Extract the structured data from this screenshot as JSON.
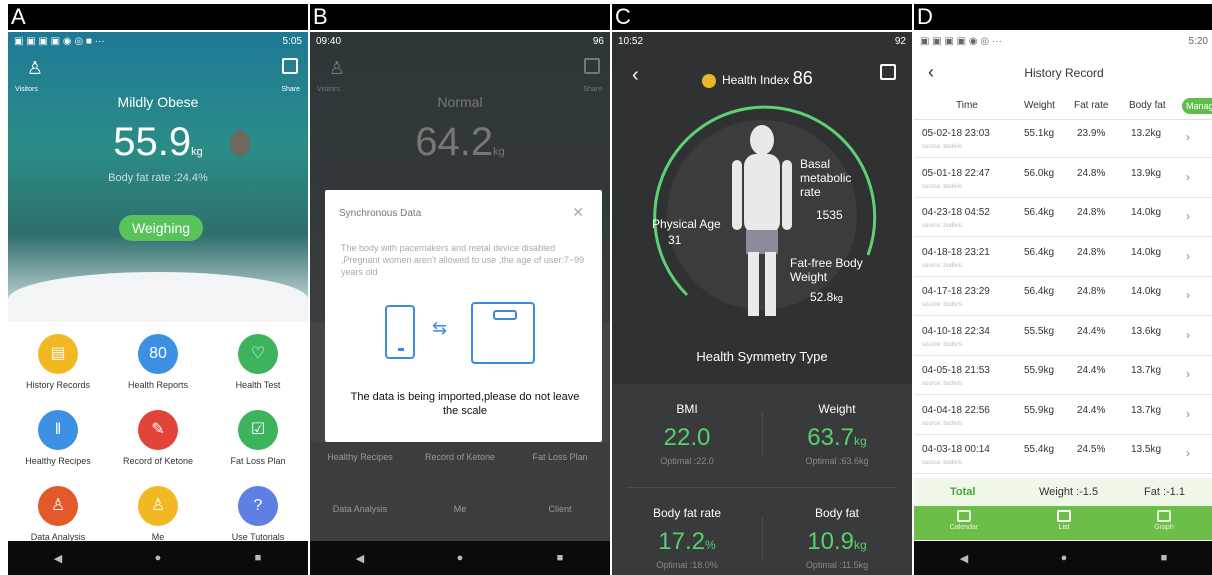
{
  "panels": {
    "a": {
      "label": "A",
      "status_time": "5:05",
      "visitors": "Visitors",
      "share": "Share",
      "status": "Mildly Obese",
      "weight": "55.9",
      "unit": "kg",
      "body_fat": "Body fat rate :24.4%",
      "weighing_button": "Weighing",
      "grid": [
        {
          "label": "History Records",
          "color": "#f2b824",
          "icon": "document-icon",
          "glyph": "▤"
        },
        {
          "label": "Health Reports",
          "color": "#3d8fe3",
          "icon": "score-icon",
          "glyph": "80"
        },
        {
          "label": "Health Test",
          "color": "#3cb35c",
          "icon": "heartbeat-icon",
          "glyph": "♡"
        },
        {
          "label": "Healthy Recipes",
          "color": "#3d8fe3",
          "icon": "fork-knife-icon",
          "glyph": "ǁ"
        },
        {
          "label": "Record of Ketone",
          "color": "#e3443a",
          "icon": "pen-icon",
          "glyph": "✎"
        },
        {
          "label": "Fat Loss Plan",
          "color": "#3cb35c",
          "icon": "clipboard-icon",
          "glyph": "☑"
        },
        {
          "label": "Data Analysis",
          "color": "#e35a2a",
          "icon": "person-pin-icon",
          "glyph": "♙"
        },
        {
          "label": "Me",
          "color": "#f2b824",
          "icon": "user-icon",
          "glyph": "♙"
        },
        {
          "label": "Use Tutorials",
          "color": "#5f7fe3",
          "icon": "chat-icon",
          "glyph": "?"
        }
      ]
    },
    "b": {
      "label": "B",
      "status_time": "09:40",
      "status_battery": "96",
      "visitors": "Visitors",
      "share": "Share",
      "status": "Normal",
      "weight": "64.2",
      "unit": "kg",
      "dialog_title": "Synchronous Data",
      "dialog_body": "The body with pacemakers and metal device disabled ,Pregnant women aren't allowed to use ,the age of user:7~99 years old",
      "dialog_message": "The data is being imported,please do not leave the scale",
      "grid_bottom": [
        "Healthy Recipes",
        "Record of Ketone",
        "Fat Loss Plan",
        "Data Analysis",
        "Me",
        "Client"
      ]
    },
    "c": {
      "label": "C",
      "status_time": "10:52",
      "status_battery": "92",
      "title": "Health Index",
      "index": "86",
      "physical_age_label": "Physical Age",
      "physical_age": "31",
      "bmr_label": "Basal metabolic rate",
      "bmr": "1535",
      "ffm_label": "Fat-free Body Weight",
      "ffm": "52.8",
      "ffm_unit": "kg",
      "symmetry": "Health Symmetry Type",
      "metrics": [
        {
          "label": "BMI",
          "value": "22.0",
          "unit": "",
          "optimal": "Optimal :22.0"
        },
        {
          "label": "Weight",
          "value": "63.7",
          "unit": "kg",
          "optimal": "Optimal :63.6kg"
        },
        {
          "label": "Body fat rate",
          "value": "17.2",
          "unit": "%",
          "optimal": "Optimal :18.0%"
        },
        {
          "label": "Body fat",
          "value": "10.9",
          "unit": "kg",
          "optimal": "Optimal :11.5kg"
        }
      ]
    },
    "d": {
      "label": "D",
      "status_time": "5:20",
      "title": "History Record",
      "columns": [
        "Time",
        "Weight",
        "Fat rate",
        "Body fat"
      ],
      "manage": "Manage",
      "source": "source: bodivis",
      "rows": [
        {
          "time": "05-02-18 23:03",
          "weight": "55.1kg",
          "fat": "23.9%",
          "bodyfat": "13.2kg"
        },
        {
          "time": "05-01-18 22:47",
          "weight": "56.0kg",
          "fat": "24.8%",
          "bodyfat": "13.9kg"
        },
        {
          "time": "04-23-18 04:52",
          "weight": "56.4kg",
          "fat": "24.8%",
          "bodyfat": "14.0kg"
        },
        {
          "time": "04-18-18 23:21",
          "weight": "56.4kg",
          "fat": "24.8%",
          "bodyfat": "14.0kg"
        },
        {
          "time": "04-17-18 23:29",
          "weight": "56.4kg",
          "fat": "24.8%",
          "bodyfat": "14.0kg"
        },
        {
          "time": "04-10-18 22:34",
          "weight": "55.5kg",
          "fat": "24.4%",
          "bodyfat": "13.6kg"
        },
        {
          "time": "04-05-18 21:53",
          "weight": "55.9kg",
          "fat": "24.4%",
          "bodyfat": "13.7kg"
        },
        {
          "time": "04-04-18 22:56",
          "weight": "55.9kg",
          "fat": "24.4%",
          "bodyfat": "13.7kg"
        },
        {
          "time": "04-03-18 00:14",
          "weight": "55.4kg",
          "fat": "24.5%",
          "bodyfat": "13.5kg"
        }
      ],
      "total_label": "Total",
      "total_weight": "Weight :-1.5",
      "total_fat": "Fat :-1.1",
      "tabs": [
        "Calendar",
        "List",
        "Graph"
      ]
    }
  },
  "android_nav": {
    "back": "◀",
    "home": "●",
    "recent": "■"
  }
}
